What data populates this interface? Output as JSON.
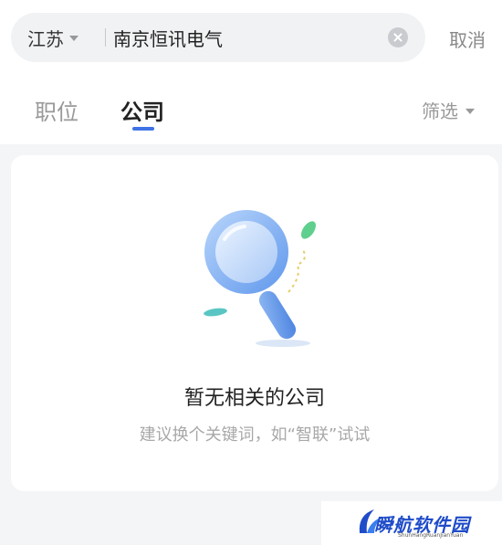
{
  "search": {
    "region": "江苏",
    "query": "南京恒讯电气",
    "cancel_label": "取消"
  },
  "tabs": [
    {
      "label": "职位",
      "active": false
    },
    {
      "label": "公司",
      "active": true
    }
  ],
  "filter": {
    "label": "筛选"
  },
  "empty_state": {
    "title": "暂无相关的公司",
    "hint": "建议换个关键词，如“智联”试试",
    "icon": "magnifier-illustration"
  },
  "watermark": {
    "text": "瞬航软件园",
    "subtext": "ShunHangRuanJianYuan"
  },
  "colors": {
    "accent": "#3f73e6",
    "background": "#f4f5f7",
    "muted_text": "#999999"
  }
}
